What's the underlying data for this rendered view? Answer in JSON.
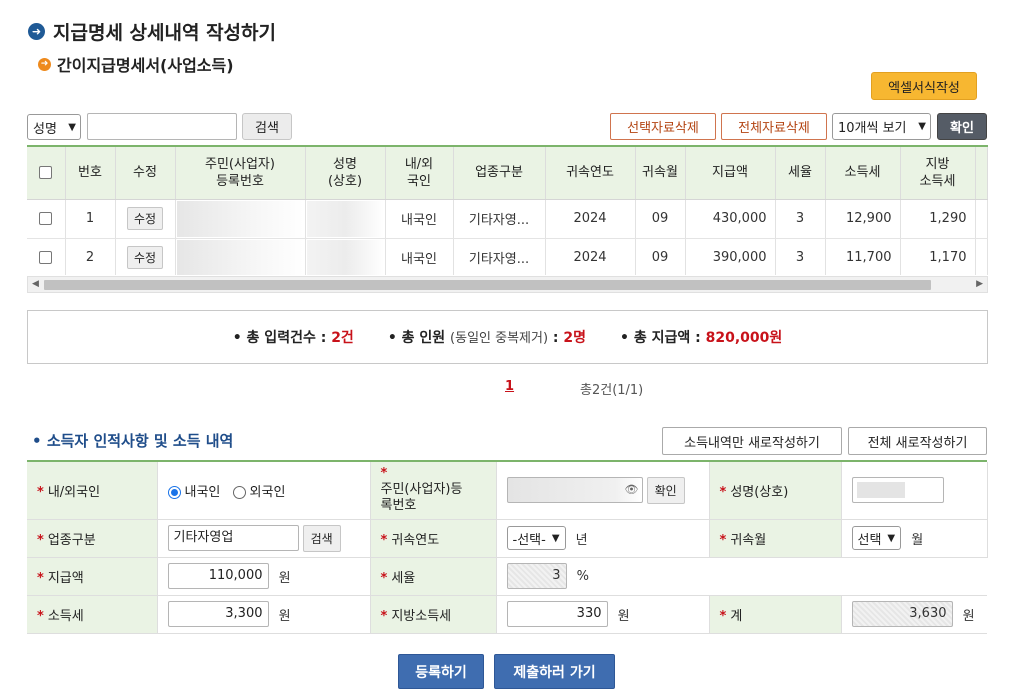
{
  "page": {
    "title": "지급명세 상세내역 작성하기",
    "subtitle": "간이지급명세서(사업소득)"
  },
  "toolbar": {
    "excel_button": "엑셀서식작성",
    "search_field_select": "성명",
    "search_input_value": "",
    "search_button": "검색",
    "delete_selected_button": "선택자료삭제",
    "delete_all_button": "전체자료삭제",
    "page_size_select": "10개씩 보기",
    "confirm_button": "확인"
  },
  "table": {
    "headers": {
      "no": "번호",
      "edit": "수정",
      "reg_no_line1": "주민(사업자)",
      "reg_no_line2": "등록번호",
      "name_line1": "성명",
      "name_line2": "(상호)",
      "nat_line1": "내/외",
      "nat_line2": "국인",
      "biz_type": "업종구분",
      "year": "귀속연도",
      "month": "귀속월",
      "amount": "지급액",
      "rate": "세율",
      "tax": "소득세",
      "local_line1": "지방",
      "local_line2": "소득세"
    },
    "rows": [
      {
        "no": "1",
        "edit": "수정",
        "nat": "내국인",
        "biz_type": "기타자영...",
        "year": "2024",
        "month": "09",
        "amount": "430,000",
        "rate": "3",
        "tax": "12,900",
        "local": "1,290"
      },
      {
        "no": "2",
        "edit": "수정",
        "nat": "내국인",
        "biz_type": "기타자영...",
        "year": "2024",
        "month": "09",
        "amount": "390,000",
        "rate": "3",
        "tax": "11,700",
        "local": "1,170"
      }
    ]
  },
  "summary": {
    "count_label": "• 총 입력건수 :",
    "count_value": "2건",
    "people_label": "• 총 인원",
    "people_note": "(동일인 중복제거)",
    "people_sep": ":",
    "people_value": "2명",
    "amount_label": "• 총 지급액 :",
    "amount_value": "820,000원"
  },
  "pager": {
    "current": "1",
    "total": "총2건(1/1)"
  },
  "section": {
    "title": "소득자 인적사항 및 소득 내역",
    "new_income_button": "소득내역만 새로작성하기",
    "new_all_button": "전체 새로작성하기"
  },
  "form": {
    "req_mark": "*",
    "nationality_label": "내/외국인",
    "domestic_option": "내국인",
    "foreign_option": "외국인",
    "reg_no_label_line1": "주민(사업자)등",
    "reg_no_label_line2": "록번호",
    "reg_no_confirm": "확인",
    "name_label": "성명(상호)",
    "biz_type_label": "업종구분",
    "biz_type_value": "기타자영업",
    "biz_search_button": "검색",
    "year_label": "귀속연도",
    "year_select": "-선택-",
    "year_unit": "년",
    "month_label": "귀속월",
    "month_select": "선택",
    "month_unit": "월",
    "amount_label": "지급액",
    "amount_value": "110,000",
    "won": "원",
    "rate_label": "세율",
    "rate_value": "3",
    "rate_unit": "%",
    "tax_label": "소득세",
    "tax_value": "3,300",
    "local_tax_label": "지방소득세",
    "local_tax_value": "330",
    "total_label": "계",
    "total_value": "3,630"
  },
  "footer": {
    "register_button": "등록하기",
    "submit_button": "제출하러 가기"
  },
  "colors": {
    "header_green": "#eaf3e4",
    "accent_red": "#c8121a",
    "excel_orange": "#f7b731",
    "primary_blue": "#3f6db0"
  }
}
